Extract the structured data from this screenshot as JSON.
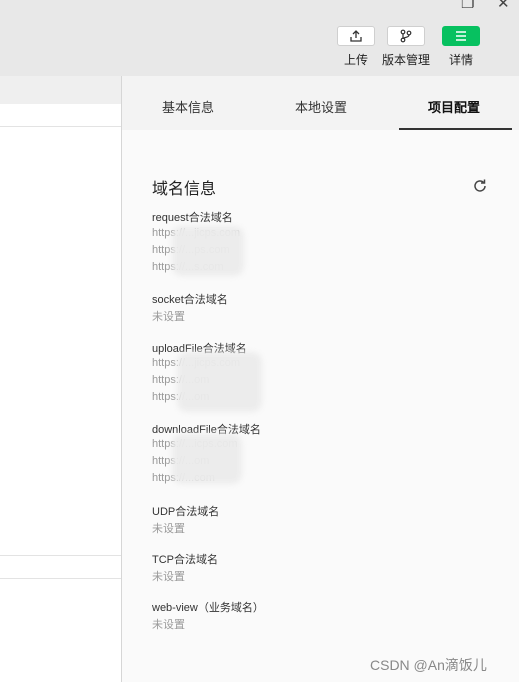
{
  "toolbar": {
    "buttons": [
      {
        "label": "上传",
        "icon": "upload-icon"
      },
      {
        "label": "版本管理",
        "icon": "branch-icon"
      },
      {
        "label": "详情",
        "icon": "menu-icon"
      }
    ],
    "accent_color": "#07c160"
  },
  "panel": {
    "tabs": [
      {
        "label": "基本信息"
      },
      {
        "label": "本地设置"
      },
      {
        "label": "项目配置",
        "active": true
      }
    ],
    "section_title": "域名信息",
    "refresh_icon": "refresh-icon",
    "fields": [
      {
        "label": "request合法域名",
        "values": [
          "https://...jicps.com",
          "https://...ps.com",
          "https://...s.com"
        ]
      },
      {
        "label": "socket合法域名",
        "values": [
          "未设置"
        ]
      },
      {
        "label": "uploadFile合法域名",
        "values": [
          "https://...jicps.com",
          "https://...om",
          "https://...om"
        ]
      },
      {
        "label": "downloadFile合法域名",
        "values": [
          "https://...icps.com",
          "https://...om",
          "https://...com"
        ]
      },
      {
        "label": "UDP合法域名",
        "values": [
          "未设置"
        ]
      },
      {
        "label": "TCP合法域名",
        "values": [
          "未设置"
        ]
      },
      {
        "label": "web-view（业务域名）",
        "values": [
          "未设置"
        ]
      }
    ]
  },
  "watermark": "CSDN @An滴饭儿"
}
